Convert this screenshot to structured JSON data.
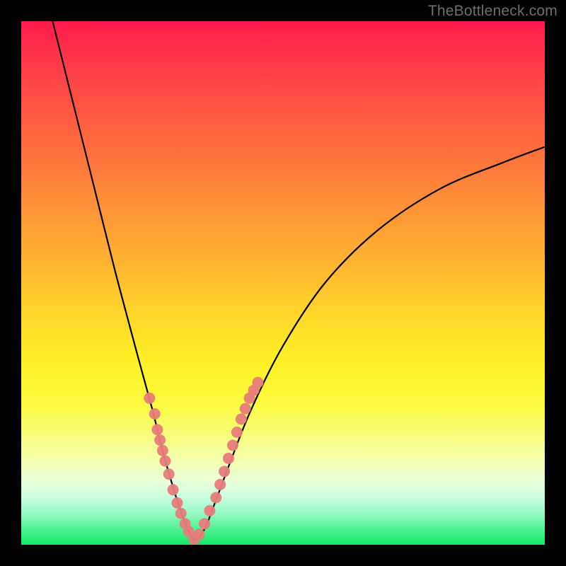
{
  "watermark": "TheBottleneck.com",
  "colors": {
    "frame": "#000000",
    "curve": "#000000",
    "markers": "#e77d7a",
    "gradient_top": "#ff1a4d",
    "gradient_bottom": "#14e765"
  },
  "chart_data": {
    "type": "line",
    "title": "",
    "xlabel": "",
    "ylabel": "",
    "xlim": [
      0,
      100
    ],
    "ylim": [
      0,
      100
    ],
    "grid": false,
    "legend": false,
    "note": "V-shaped bottleneck curve; y≈100 is worst (red), y≈0 best (green). Minimum near x≈33.",
    "series": [
      {
        "name": "bottleneck-curve",
        "x": [
          6,
          10,
          14,
          18,
          22,
          25,
          27,
          29,
          31,
          33,
          35,
          37,
          40,
          44,
          50,
          58,
          68,
          80,
          92,
          100
        ],
        "y": [
          100,
          84,
          68,
          52,
          37,
          26,
          18,
          11,
          5,
          1,
          3,
          8,
          16,
          26,
          38,
          50,
          60,
          68,
          73,
          76
        ]
      }
    ],
    "markers": {
      "name": "highlighted-points",
      "note": "Pink dot clusters on both slopes near the minimum",
      "x": [
        24.5,
        25.5,
        26,
        26.5,
        27,
        27.5,
        28.2,
        29,
        29.8,
        30.5,
        31.3,
        32,
        33,
        34,
        35,
        36,
        37.2,
        38,
        38.8,
        39.6,
        40.4,
        41.2,
        42,
        42.8,
        43.6,
        44.4,
        45.2
      ],
      "y": [
        28,
        25,
        22,
        20,
        18,
        16,
        13.5,
        10.5,
        8,
        6,
        4,
        2.5,
        1,
        2,
        4,
        6.5,
        9,
        11.5,
        14,
        16.5,
        19,
        21.5,
        24,
        26,
        28,
        29.5,
        31
      ]
    }
  }
}
